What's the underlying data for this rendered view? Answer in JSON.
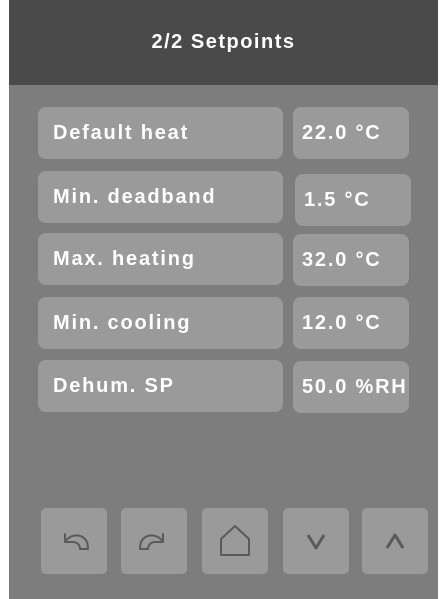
{
  "header": {
    "title": "2/2 Setpoints"
  },
  "setpoints": [
    {
      "label": "Default heat",
      "value": "22.0 °C"
    },
    {
      "label": "Min. deadband",
      "value": "1.5 °C"
    },
    {
      "label": "Max. heating",
      "value": "32.0 °C"
    },
    {
      "label": "Min. cooling",
      "value": "12.0 °C"
    },
    {
      "label": "Dehum. SP",
      "value": "50.0 %RH"
    }
  ],
  "nav_buttons": [
    {
      "icon": "undo-arrow-icon"
    },
    {
      "icon": "redo-arrow-icon"
    },
    {
      "icon": "home-icon"
    },
    {
      "icon": "chevron-down-icon"
    },
    {
      "icon": "chevron-up-icon"
    }
  ],
  "colors": {
    "screen_background": "#7d7d7d",
    "header_background": "#4a4a4a",
    "tile": "#9a9a9a",
    "text": "#ffffff",
    "icon_stroke": "#5a5a5a"
  }
}
